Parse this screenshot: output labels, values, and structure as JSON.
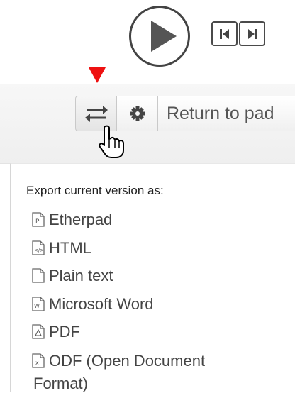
{
  "playback": {
    "play_icon": "play-icon",
    "step_back_icon": "step-backward-icon",
    "step_forward_icon": "step-forward-icon"
  },
  "marker": {
    "color": "#ee1111",
    "icon": "red-triangle-down-icon"
  },
  "toolbar": {
    "import_export_icon": "import-export-arrows-icon",
    "settings_icon": "gear-icon",
    "return_label": "Return to pad"
  },
  "cursor_icon": "hand-pointer-icon",
  "export": {
    "heading": "Export current version as:",
    "items": [
      {
        "label": "Etherpad",
        "icon": "etherpad-file-icon"
      },
      {
        "label": "HTML",
        "icon": "html-file-icon"
      },
      {
        "label": "Plain text",
        "icon": "text-file-icon"
      },
      {
        "label": "Microsoft Word",
        "icon": "word-file-icon"
      },
      {
        "label": "PDF",
        "icon": "pdf-file-icon"
      },
      {
        "label": "ODF (Open Document",
        "label_line2": "Format)",
        "icon": "odf-file-icon"
      }
    ]
  }
}
